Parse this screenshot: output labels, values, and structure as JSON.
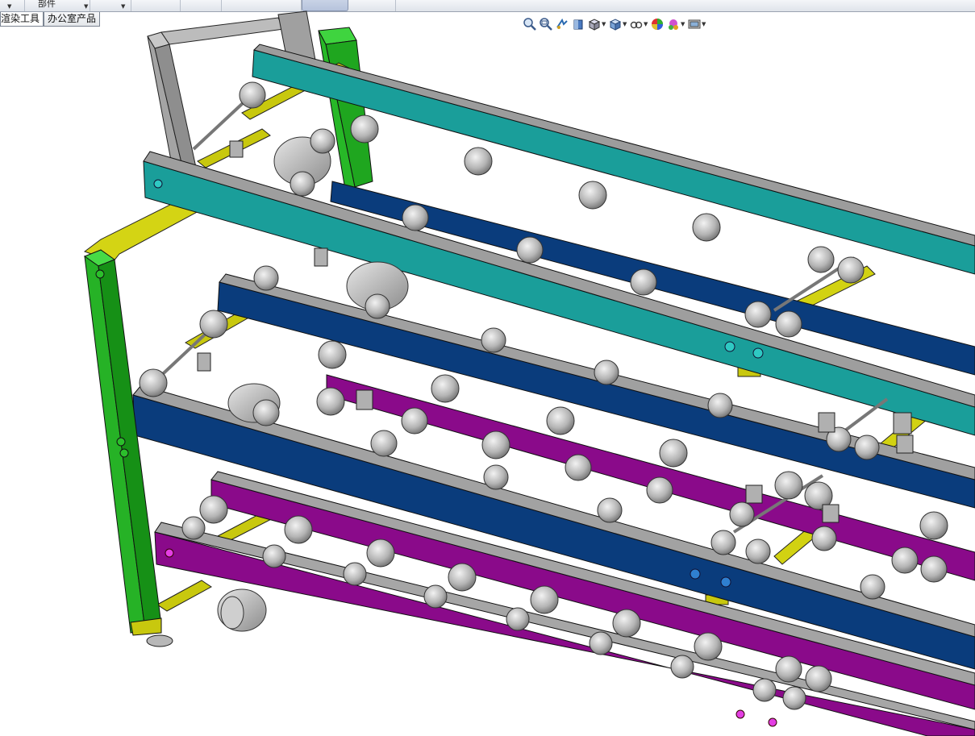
{
  "toolbar": {
    "menu_label": "部件"
  },
  "tabs": [
    {
      "label": "渲染工具"
    },
    {
      "label": "办公室产品"
    }
  ],
  "view_toolbar": {
    "icons": [
      "zoom-to-fit-icon",
      "zoom-to-area-icon",
      "previous-view-icon",
      "section-view-icon",
      "view-orientation-icon",
      "display-style-icon",
      "hide-show-items-icon",
      "edit-appearance-icon",
      "apply-scene-icon",
      "view-settings-icon"
    ]
  },
  "colors": {
    "teal_rail": "#1a9e9a",
    "blue_rail": "#0a3c7c",
    "purple_rail": "#8a0a8a",
    "green_post": "#22b422",
    "yellow_frame": "#c8c80e",
    "gray_steel": "#a8a8a8"
  }
}
